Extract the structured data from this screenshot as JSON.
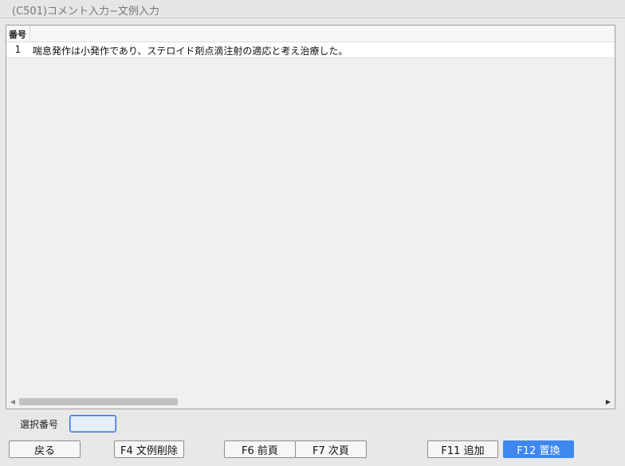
{
  "window": {
    "title": "(C501)コメント入力−文例入力"
  },
  "grid": {
    "column_header": "番号",
    "rows": [
      {
        "number": "1",
        "text": "喘息発作は小発作であり、ステロイド剤点滴注射の適応と考え治療した。"
      }
    ]
  },
  "selection": {
    "label": "選択番号",
    "value": ""
  },
  "buttons": {
    "back": "戻る",
    "f4": "F4 文例削除",
    "f6": "F6 前頁",
    "f7": "F7 次頁",
    "f11": "F11 追加",
    "f12": "F12 置換"
  },
  "colors": {
    "primary_button": "#3f86f0",
    "focus_border": "#2a6fd6"
  },
  "icons": {
    "scroll_left": "scroll-left-arrow-icon",
    "scroll_right": "scroll-right-arrow-icon"
  }
}
